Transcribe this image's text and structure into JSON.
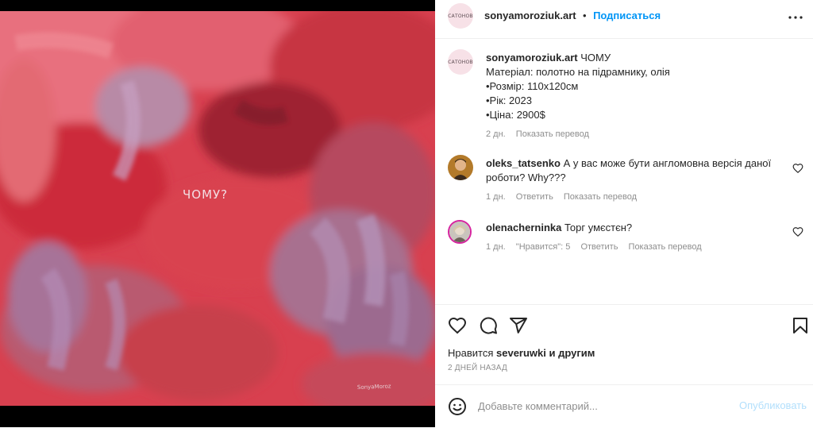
{
  "post": {
    "author": "sonyamoroziuk.art",
    "avatar_text": "САТОНОВ",
    "follow_label": "Подписаться",
    "separator": "•",
    "painting_text": "ЧОМУ?",
    "signature": "SonyaMoroz"
  },
  "caption": {
    "author": "sonyamoroziuk.art",
    "title": "ЧОМУ",
    "lines": [
      "Матеріал: полотно на підрамнику, олія",
      "•Розмір: 110х120см",
      "•Рік: 2023",
      "•Ціна: 2900$"
    ],
    "age": "2 дн.",
    "translate": "Показать перевод"
  },
  "comments": [
    {
      "author": "oleks_tatsenko",
      "text": "А у вас може бути англомовна версія даної роботи? Why???",
      "age": "1 дн.",
      "reply": "Ответить",
      "translate": "Показать перевод"
    },
    {
      "author": "olenacherninka",
      "text": "Торг умєстєн?",
      "age": "1 дн.",
      "likes": "\"Нравится\": 5",
      "reply": "Ответить",
      "translate": "Показать перевод"
    }
  ],
  "likes": {
    "prefix": "Нравится",
    "user": "severuwki",
    "suffix": "и другим"
  },
  "timestamp": "2 ДНЕЙ НАЗАД",
  "composer": {
    "placeholder": "Добавьте комментарий...",
    "publish": "Опубликовать"
  },
  "colors": {
    "accent": "#0095f6",
    "publish_disabled": "#b2dffc",
    "muted": "#8e8e8e"
  },
  "icons": [
    "more-icon",
    "heart-icon",
    "comment-icon",
    "share-icon",
    "bookmark-icon",
    "emoji-icon"
  ]
}
